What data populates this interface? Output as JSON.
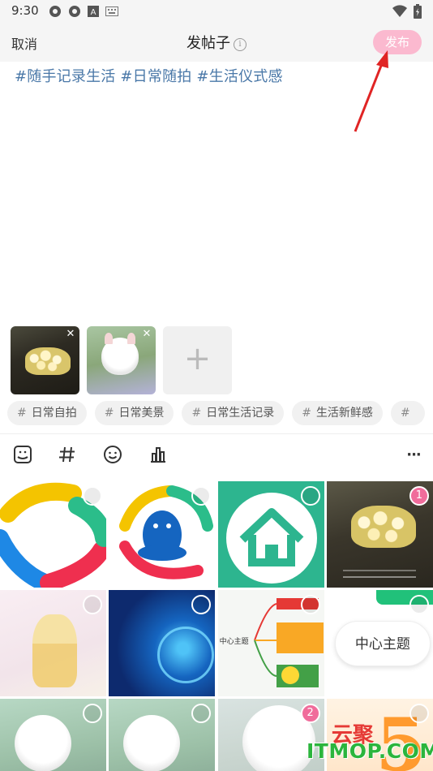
{
  "status_bar": {
    "time": "9:30",
    "icons_left": [
      "app-icon",
      "app-icon",
      "text-icon",
      "keyboard-icon"
    ],
    "icons_right": [
      "wifi-icon",
      "battery-icon"
    ]
  },
  "header": {
    "cancel_label": "取消",
    "title": "发帖子",
    "info_icon": "ⓘ",
    "publish_label": "发布",
    "publish_color": "#fbb9cf"
  },
  "editor": {
    "text": "#随手记录生活 #日常随拍 #生活仪式感"
  },
  "attachments": {
    "add_label": "+"
  },
  "tags": [
    {
      "label": "日常自拍"
    },
    {
      "label": "日常美景"
    },
    {
      "label": "日常生活记录"
    },
    {
      "label": "生活新鲜感"
    },
    {
      "label": ""
    }
  ],
  "toolbar": {
    "tools": [
      "image-icon",
      "hashtag-icon",
      "emoji-icon",
      "chart-icon"
    ],
    "more_label": "···"
  },
  "gallery": {
    "selected_1": "1",
    "selected_2": "2",
    "mindmap_center": "中心主题",
    "topic_label": "中心主题",
    "cloud_text": "云聚"
  },
  "watermark": "ITMOP.COM",
  "colors": {
    "accent_pink": "#f06c9b",
    "hashtag_blue": "#4a78a8",
    "watermark_green": "#2bb53d"
  }
}
